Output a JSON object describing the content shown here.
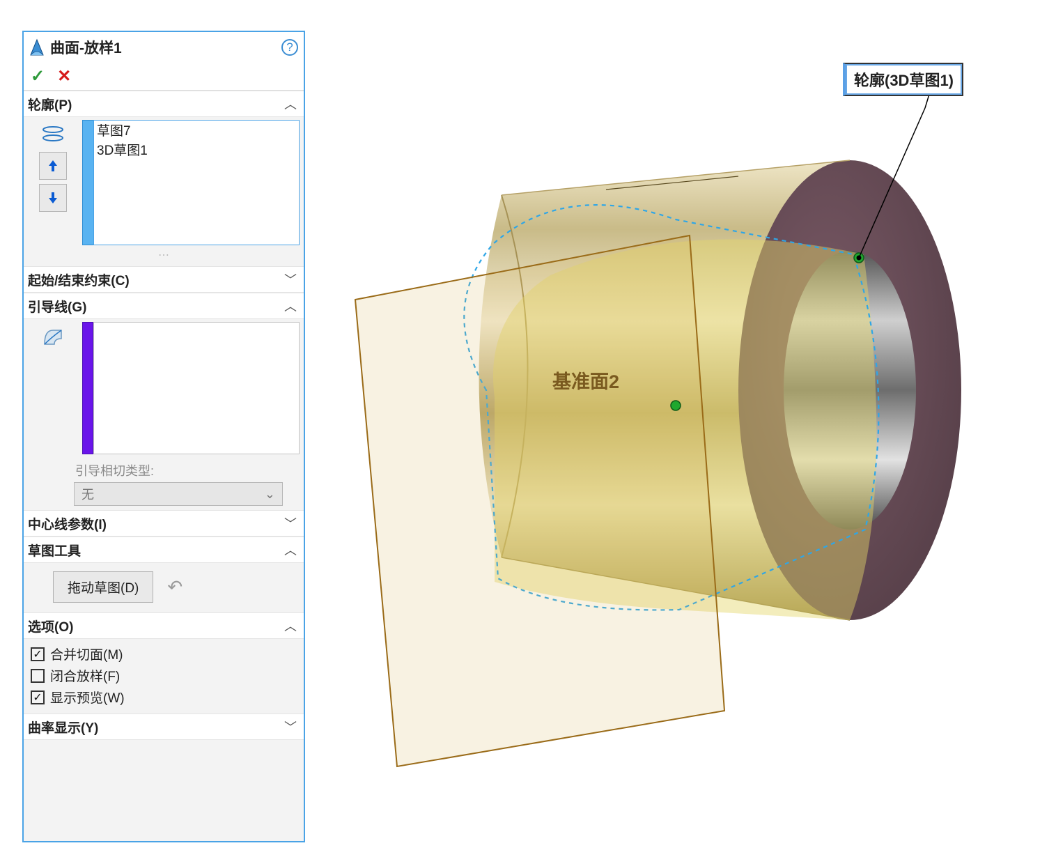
{
  "header": {
    "title": "曲面-放样1"
  },
  "sections": {
    "profiles": {
      "label": "轮廓(P)",
      "items": [
        "草图7",
        "3D草图1"
      ]
    },
    "start_end": {
      "label": "起始/结束约束(C)"
    },
    "guides": {
      "label": "引导线(G)",
      "tangency_label": "引导相切类型:",
      "tangency_value": "无"
    },
    "centerline": {
      "label": "中心线参数(I)"
    },
    "sketch_tools": {
      "label": "草图工具",
      "drag_label": "拖动草图(D)"
    },
    "options": {
      "label": "选项(O)",
      "merge": "合并切面(M)",
      "closed": "闭合放样(F)",
      "preview": "显示预览(W)"
    },
    "curvature": {
      "label": "曲率显示(Y)"
    }
  },
  "viewport": {
    "callout": "轮廓(3D草图1)",
    "datum_plane": "基准面2"
  }
}
